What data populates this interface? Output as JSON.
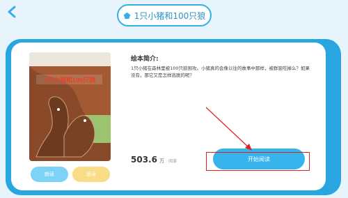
{
  "header": {
    "title": "1只小猪和100只狼",
    "back_icon": "chevron-left-icon",
    "title_icon": "pentagon-icon"
  },
  "book": {
    "cover_title": "1只小猪和100只狼"
  },
  "intro": {
    "heading": "绘本简介:",
    "text": "1只小猪在森林里被100只狼围攻。小猪真的会像以往的故事中那样，被群狼吃掉么？如果没有，那它又是怎样逃脱的呢？"
  },
  "stats": {
    "reads_value": "503.6",
    "reads_unit": "万",
    "reads_label": "阅读"
  },
  "actions": {
    "left_button": "朗读",
    "right_button": "跟读",
    "start_button": "开始阅读"
  },
  "colors": {
    "primary": "#29a6e0",
    "accent_yellow": "#f8dc86",
    "annotation_red": "#e02020"
  }
}
